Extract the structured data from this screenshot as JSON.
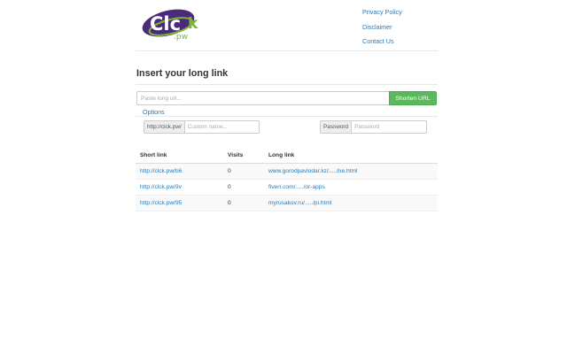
{
  "logo": {
    "text": "Click.pw"
  },
  "nav": {
    "items": [
      "Privacy Policy",
      "Disclaimer",
      "Contact Us"
    ]
  },
  "form": {
    "heading": "Insert your long link",
    "url_placeholder": "Paste long url...",
    "shorten_label": "Shorten URL",
    "options_label": "Options",
    "prefix_label": "http://clck.pw/",
    "custom_name_placeholder": "Custom name...",
    "password_label": "Password",
    "password_placeholder": "Password"
  },
  "table": {
    "headers": [
      "Short link",
      "Visits",
      "Long link"
    ],
    "rows": [
      {
        "short": "http://clck.pw/b6",
        "visits": "0",
        "long": "www.gorodpavlodar.kz/...../ne.html"
      },
      {
        "short": "http://clck.pw/9v",
        "visits": "0",
        "long": "fiverr.com/...../or-apps"
      },
      {
        "short": "http://clck.pw/95",
        "visits": "0",
        "long": "myrusakov.ru/...../pi.html"
      }
    ]
  },
  "colors": {
    "brand_purple": "#4a2a7a",
    "brand_green": "#7ab630",
    "link": "#2a7ab5",
    "button": "#5cb85c"
  }
}
